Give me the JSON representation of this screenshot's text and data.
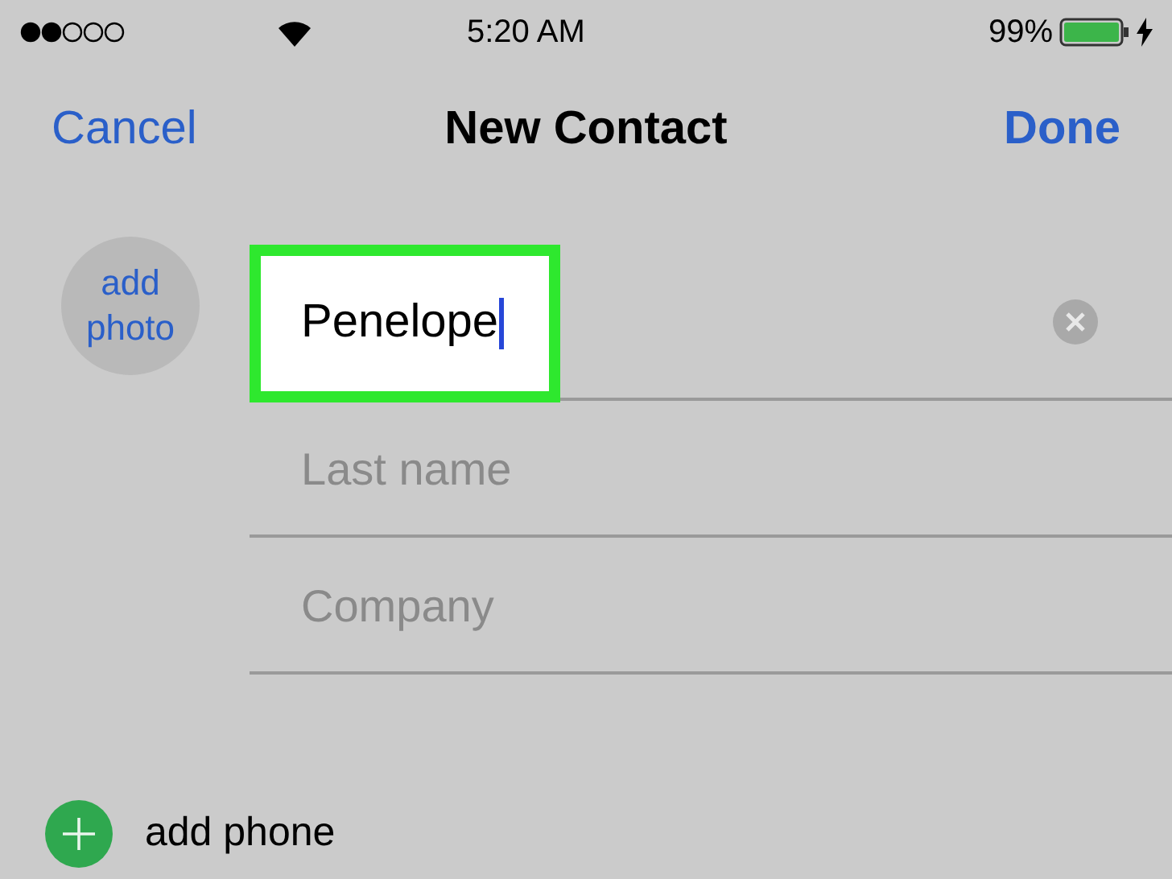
{
  "status_bar": {
    "time": "5:20 AM",
    "battery": "99%"
  },
  "nav": {
    "cancel": "Cancel",
    "title": "New Contact",
    "done": "Done"
  },
  "photo": {
    "label": "add photo"
  },
  "fields": [
    {
      "value": "Penelope",
      "highlighted": true,
      "focused": true
    },
    {
      "placeholder": "Last name",
      "highlighted": false,
      "focused": false
    },
    {
      "placeholder": "Company",
      "highlighted": false,
      "focused": false
    }
  ],
  "add_phone": {
    "label": "add phone"
  }
}
